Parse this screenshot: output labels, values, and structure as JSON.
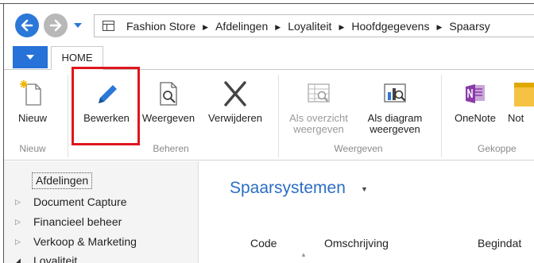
{
  "breadcrumb": {
    "items": [
      "Fashion Store",
      "Afdelingen",
      "Loyaliteit",
      "Hoofdgegevens",
      "Spaarsy"
    ]
  },
  "tabs": {
    "home": "HOME"
  },
  "ribbon": {
    "nieuw": {
      "button": "Nieuw",
      "group": "Nieuw"
    },
    "beheren": {
      "group": "Beheren",
      "bewerken": "Bewerken",
      "weergeven": "Weergeven",
      "verwijderen": "Verwijderen"
    },
    "weergeven": {
      "group": "Weergeven",
      "als_overzicht_1": "Als overzicht",
      "als_overzicht_2": "weergeven",
      "als_diagram_1": "Als diagram",
      "als_diagram_2": "weergeven"
    },
    "gekoppeld": {
      "group": "Gekoppe",
      "onenote": "OneNote",
      "notes": "Not"
    }
  },
  "navpane": {
    "items": [
      {
        "label": "Afdelingen"
      },
      {
        "label": "Document Capture"
      },
      {
        "label": "Financieel beheer"
      },
      {
        "label": "Verkoop & Marketing"
      },
      {
        "label": "Loyaliteit"
      }
    ]
  },
  "content": {
    "title": "Spaarsystemen",
    "columns": [
      "Code",
      "Omschrijving",
      "Begindat"
    ]
  },
  "colors": {
    "accent": "#2b78d8",
    "title": "#2b6fc4",
    "highlight": "#e0151c",
    "onenote": "#8a3aa8"
  }
}
